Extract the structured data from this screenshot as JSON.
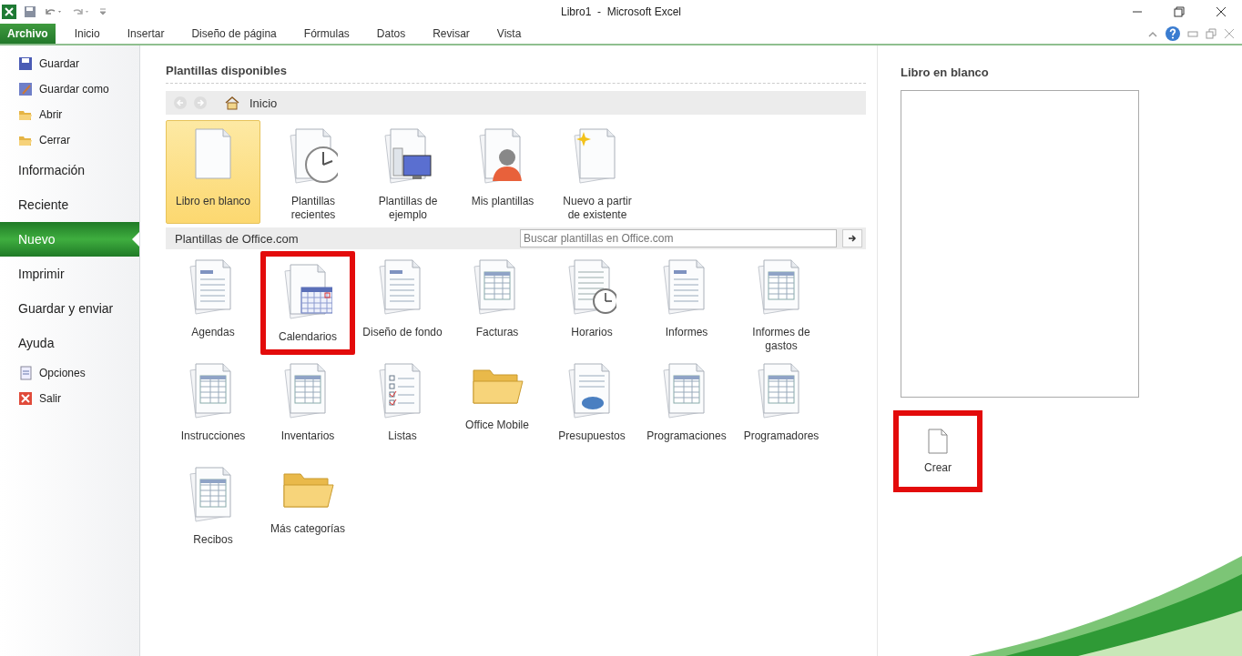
{
  "window": {
    "title": "Libro1  -  Microsoft Excel"
  },
  "ribbon_tabs": [
    {
      "label": "Archivo",
      "kind": "file",
      "selected": true
    },
    {
      "label": "Inicio",
      "kind": "tab",
      "selected": false
    },
    {
      "label": "Insertar",
      "kind": "tab",
      "selected": false
    },
    {
      "label": "Diseño de página",
      "kind": "tab",
      "selected": false
    },
    {
      "label": "Fórmulas",
      "kind": "tab",
      "selected": false
    },
    {
      "label": "Datos",
      "kind": "tab",
      "selected": false
    },
    {
      "label": "Revisar",
      "kind": "tab",
      "selected": false
    },
    {
      "label": "Vista",
      "kind": "tab",
      "selected": false
    }
  ],
  "sidebar": {
    "items": [
      {
        "label": "Guardar",
        "kind": "command",
        "selected": false
      },
      {
        "label": "Guardar como",
        "kind": "command",
        "selected": false
      },
      {
        "label": "Abrir",
        "kind": "command",
        "selected": false
      },
      {
        "label": "Cerrar",
        "kind": "command",
        "selected": false
      },
      {
        "label": "Información",
        "kind": "section",
        "selected": false
      },
      {
        "label": "Reciente",
        "kind": "section",
        "selected": false
      },
      {
        "label": "Nuevo",
        "kind": "section",
        "selected": true
      },
      {
        "label": "Imprimir",
        "kind": "section",
        "selected": false
      },
      {
        "label": "Guardar y enviar",
        "kind": "section",
        "selected": false
      },
      {
        "label": "Ayuda",
        "kind": "section",
        "selected": false
      },
      {
        "label": "Opciones",
        "kind": "command",
        "selected": false
      },
      {
        "label": "Salir",
        "kind": "command",
        "selected": false
      }
    ]
  },
  "templates": {
    "heading": "Plantillas disponibles",
    "breadcrumb": "Inicio",
    "items": [
      {
        "label": "Libro en blanco",
        "kind": "blank",
        "selected": true
      },
      {
        "label": "Plantillas recientes",
        "kind": "recent",
        "selected": false
      },
      {
        "label": "Plantillas de ejemplo",
        "kind": "sample",
        "selected": false
      },
      {
        "label": "Mis plantillas",
        "kind": "mine",
        "selected": false
      },
      {
        "label": "Nuevo a partir de existente",
        "kind": "existing",
        "selected": false
      }
    ],
    "office": {
      "label": "Plantillas de Office.com",
      "search_placeholder": "Buscar plantillas en Office.com",
      "items": [
        {
          "label": "Agendas",
          "kind": "doc",
          "highlighted": false
        },
        {
          "label": "Calendarios",
          "kind": "calendar",
          "highlighted": true
        },
        {
          "label": "Diseño de fondo",
          "kind": "doc",
          "highlighted": false
        },
        {
          "label": "Facturas",
          "kind": "table",
          "highlighted": false
        },
        {
          "label": "Horarios",
          "kind": "clock",
          "highlighted": false
        },
        {
          "label": "Informes",
          "kind": "doc",
          "highlighted": false
        },
        {
          "label": "Informes de gastos",
          "kind": "table",
          "highlighted": false
        },
        {
          "label": "Instrucciones",
          "kind": "table",
          "highlighted": false
        },
        {
          "label": "Inventarios",
          "kind": "table",
          "highlighted": false
        },
        {
          "label": "Listas",
          "kind": "checklist",
          "highlighted": false
        },
        {
          "label": "Office Mobile",
          "kind": "folder",
          "highlighted": false
        },
        {
          "label": "Presupuestos",
          "kind": "pie",
          "highlighted": false
        },
        {
          "label": "Programaciones",
          "kind": "table",
          "highlighted": false
        },
        {
          "label": "Programadores",
          "kind": "table",
          "highlighted": false
        },
        {
          "label": "Recibos",
          "kind": "table",
          "highlighted": false
        },
        {
          "label": "Más categorías",
          "kind": "folder",
          "highlighted": false
        }
      ]
    }
  },
  "preview": {
    "title": "Libro en blanco",
    "create_label": "Crear",
    "create_highlighted": true
  }
}
